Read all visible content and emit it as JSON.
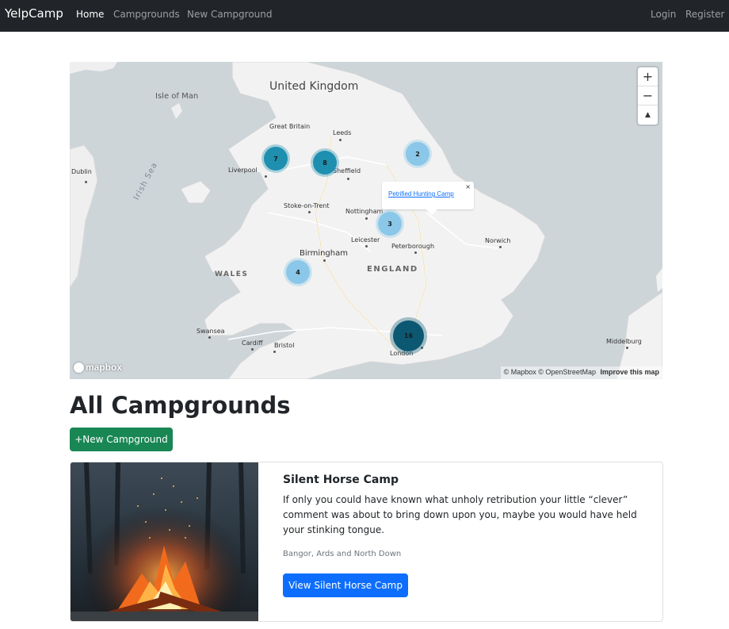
{
  "navbar": {
    "brand": "YelpCamp",
    "links": [
      {
        "label": "Home",
        "active": true
      },
      {
        "label": "Campgrounds"
      },
      {
        "label": "New Campground"
      }
    ],
    "auth": [
      {
        "label": "Login"
      },
      {
        "label": "Register"
      }
    ]
  },
  "map": {
    "country_label": "United Kingdom",
    "sub_label": "Great Britain",
    "region_labels": {
      "england": "ENGLAND",
      "wales": "WALES",
      "isle_of_man": "Isle of Man",
      "irish_sea": "Irish Sea"
    },
    "cities": {
      "leeds": "Leeds",
      "liverpool": "Liverpool",
      "sheffield": "Sheffield",
      "stoke": "Stoke-on-Trent",
      "nottingham": "Nottingham",
      "leicester": "Leicester",
      "peterborough": "Peterborough",
      "norwich": "Norwich",
      "birmingham": "Birmingham",
      "swansea": "Swansea",
      "cardiff": "Cardiff",
      "bristol": "Bristol",
      "london": "London",
      "dublin": "Dublin",
      "middelburg": "Middelburg"
    },
    "clusters": [
      {
        "count": "7",
        "shade": "mid"
      },
      {
        "count": "8",
        "shade": "mid"
      },
      {
        "count": "2",
        "shade": "light"
      },
      {
        "count": "3",
        "shade": "light"
      },
      {
        "count": "4",
        "shade": "light"
      },
      {
        "count": "16",
        "shade": "dark"
      }
    ],
    "popup": {
      "link_text": "Petrified Hunting Camp",
      "close": "×"
    },
    "controls": {
      "zoom_in": "+",
      "zoom_out": "−",
      "reset_north": "▲"
    },
    "logo": "mapbox",
    "attribution": {
      "mapbox": "© Mapbox",
      "osm": "© OpenStreetMap",
      "improve": "Improve this map"
    }
  },
  "page": {
    "title": "All Campgrounds",
    "new_button": "+New Campground"
  },
  "campground": {
    "title": "Silent Horse Camp",
    "description": "If only you could have known what unholy retribution your little “clever” comment was about to bring down upon you, maybe you would have held your stinking tongue.",
    "location": "Bangor, Ards and North Down",
    "button": "View Silent Horse Camp"
  },
  "colors": {
    "navbar_bg": "#212529",
    "success": "#198754",
    "primary": "#0d6efd",
    "cluster_light": "#8ac7e8",
    "cluster_mid": "#1f8fb0",
    "cluster_dark": "#0c5873"
  }
}
